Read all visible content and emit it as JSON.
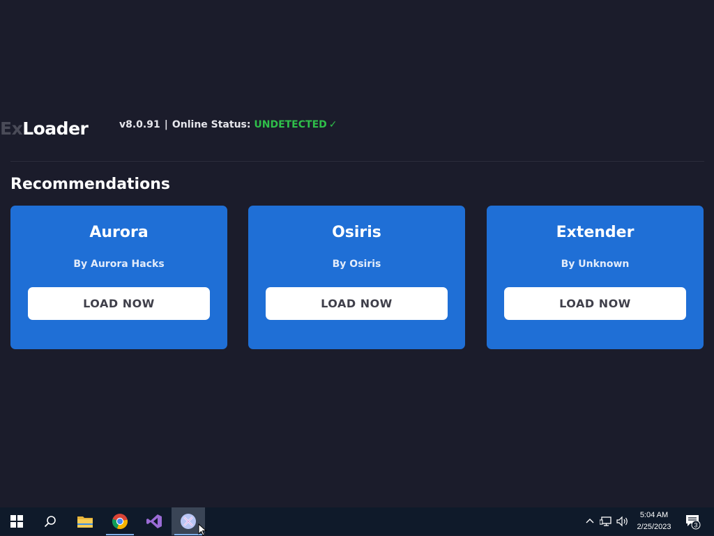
{
  "app": {
    "logo_prefix": "Ex",
    "logo_suffix": "Loader",
    "version": "v8.0.91",
    "separator": "|",
    "status_label": "Online Status:",
    "status_value": "UNDETECTED",
    "status_check": "✓",
    "section_title": "Recommendations",
    "colors": {
      "background": "#1b1c2b",
      "card": "#1f6fd6",
      "status_ok": "#2fbf4a"
    }
  },
  "cards": [
    {
      "title": "Aurora",
      "author": "By Aurora Hacks",
      "button": "LOAD NOW"
    },
    {
      "title": "Osiris",
      "author": "By Osiris",
      "button": "LOAD NOW"
    },
    {
      "title": "Extender",
      "author": "By Unknown",
      "button": "LOAD NOW"
    }
  ],
  "taskbar": {
    "apps": [
      "start-icon",
      "search-icon",
      "file-explorer-icon",
      "chrome-icon",
      "visual-studio-icon",
      "exloader-icon"
    ],
    "time": "5:04 AM",
    "date": "2/25/2023",
    "notification_count": "3"
  }
}
